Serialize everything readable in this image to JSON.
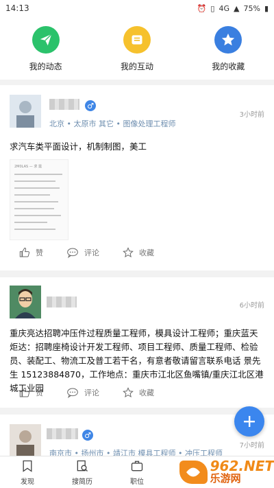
{
  "status": {
    "time": "14:13",
    "battery": "75%",
    "network": "4G"
  },
  "quick": [
    {
      "label": "我的动态",
      "color": "#2bc26b",
      "icon": "paper-plane-icon"
    },
    {
      "label": "我的互动",
      "color": "#f6c12d",
      "icon": "chat-box-icon"
    },
    {
      "label": "我的收藏",
      "color": "#3a7fe0",
      "icon": "star-icon"
    }
  ],
  "posts": [
    {
      "meta": "北京 • 太原市 其它 • 图像处理工程师",
      "time": "3小时前",
      "content": "求汽车类平面设计，机制制图，美工",
      "thumb_title": "2M0LAS — 求 需",
      "actions": {
        "like": "赞",
        "comment": "评论",
        "fav": "收藏"
      }
    },
    {
      "time": "6小时前",
      "content": "重庆亮达招聘冲压件过程质量工程师，模具设计工程师；重庆蓝天炬达：招聘座椅设计开发工程师、项目工程师、质量工程师、检验员、装配工、物流工及普工若干名，有意者敬请留言联系电话 景先生 15123884870，工作地点：重庆市江北区鱼嘴镇/重庆江北区港城工业园",
      "actions": {
        "like": "赞",
        "comment": "评论",
        "fav": "收藏"
      }
    },
    {
      "meta": "南京市 • 扬州市 • 靖江市 模具工程师 • 冲压工程师",
      "time": "7小时前"
    }
  ],
  "tabs": [
    {
      "label": "发现",
      "icon": "bookmark-icon"
    },
    {
      "label": "搜简历",
      "icon": "resume-search-icon"
    },
    {
      "label": "职位",
      "icon": "briefcase-icon"
    }
  ],
  "watermark": {
    "text": "962.NET",
    "subtext": "乐游网"
  }
}
